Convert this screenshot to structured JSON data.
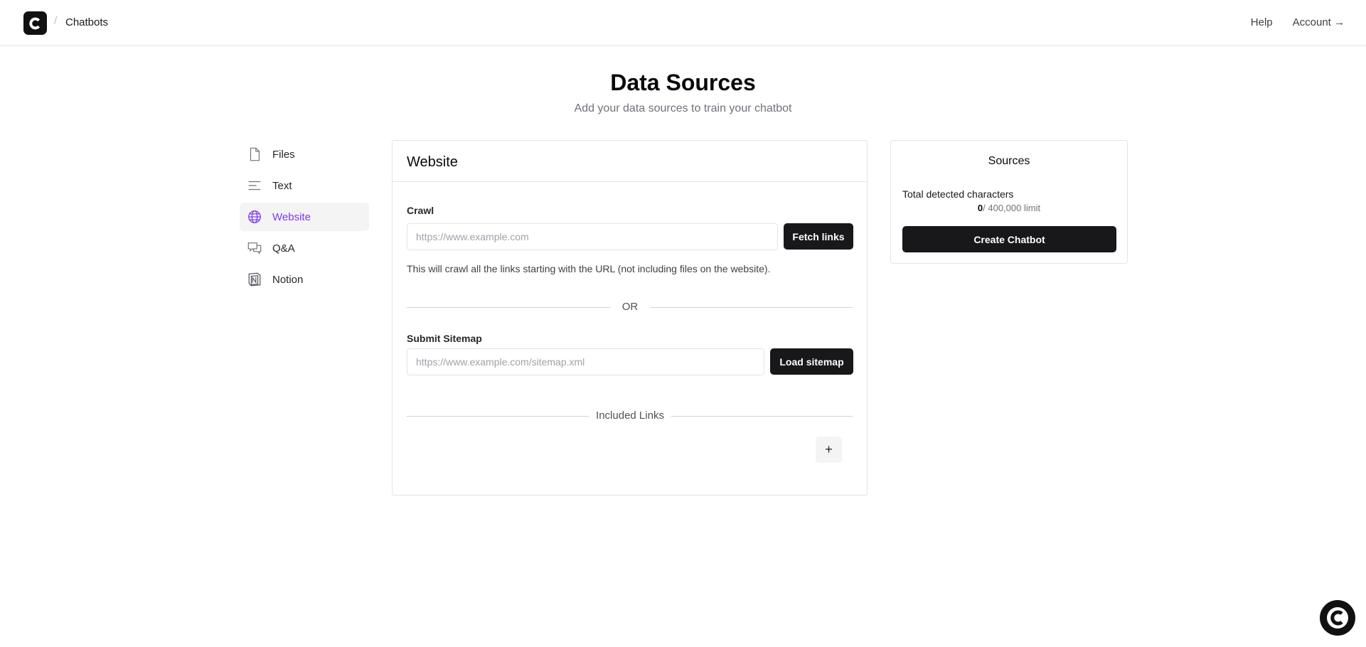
{
  "header": {
    "breadcrumb_separator": "/",
    "breadcrumb": "Chatbots",
    "help": "Help",
    "account": "Account →"
  },
  "page": {
    "title": "Data Sources",
    "subtitle": "Add your data sources to train your chatbot"
  },
  "sidebar": {
    "items": [
      {
        "label": "Files",
        "icon": "file-icon"
      },
      {
        "label": "Text",
        "icon": "text-lines-icon"
      },
      {
        "label": "Website",
        "icon": "globe-icon",
        "active": true
      },
      {
        "label": "Q&A",
        "icon": "chat-bubbles-icon"
      },
      {
        "label": "Notion",
        "icon": "notion-icon"
      }
    ]
  },
  "website": {
    "title": "Website",
    "crawl_label": "Crawl",
    "crawl_placeholder": "https://www.example.com",
    "crawl_value": "",
    "fetch_button": "Fetch links",
    "crawl_hint": "This will crawl all the links starting with the URL (not including files on the website).",
    "or_label": "OR",
    "sitemap_label": "Submit Sitemap",
    "sitemap_placeholder": "https://www.example.com/sitemap.xml",
    "sitemap_value": "",
    "load_button": "Load sitemap",
    "included_links_label": "Included Links",
    "add_button": "+"
  },
  "sources": {
    "title": "Sources",
    "total_label": "Total detected characters",
    "count": "0",
    "limit": "/ 400,000 limit",
    "create_button": "Create Chatbot"
  },
  "colors": {
    "accent": "#7c3aed",
    "dark": "#18181b",
    "border": "#e4e4e7"
  }
}
